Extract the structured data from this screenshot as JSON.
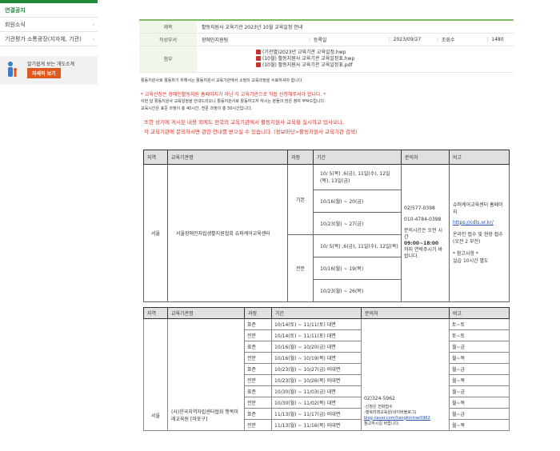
{
  "sidebar": {
    "items": [
      {
        "label": "연결공지",
        "active": true
      },
      {
        "label": "회원소식"
      },
      {
        "label": "기관평가 소통광장(지자체, 기관)"
      }
    ],
    "banner": {
      "text": "알기쉽게 보는 개도소개",
      "button": "자세히 보기"
    }
  },
  "post": {
    "title_label": "제목",
    "title": "활동지원사 교육기관 2023년 10월 교육일정 안내",
    "author_label": "작성부서",
    "author": "장애인지원팀",
    "date_label": "등록일",
    "date": "2023/09/27",
    "views_label": "조회수",
    "views": "1480",
    "attach_label": "첨부",
    "attachments": [
      "(기관별)2023년 교육기관 교육일정.hwp",
      "(10월) 활동지원사 교육기관 교육일정표.hwp",
      "(10월) 활동지원사 교육기관 교육일정표.pdf"
    ]
  },
  "content": {
    "intro": "활동지원사로 활동하기 위해서는 활동지원사 교육기관에서 소정의 교육과정을 수료하셔야 합니다.",
    "notice1": "* 교육신청은 장애인활동지원 홈페이지가 아닌 각 교육기관으로 직접 신청해주셔야 합니다. *",
    "line2": "이번 달 활동지원사 교육일정을 안내드리오니 활동지원사로 활동하고자 하시는 분들의 많은 참여 부탁드립니다.",
    "line3": "교육시간은 표준 과정이 총 40시간, 전문 과정이 총 50시간입니다.",
    "notice2": "또한 상기에 게시된 내용 외에도 전국의 교육기관에서 활동지원사 교육을 실시하고 있사오니,",
    "notice3": "각 교육기관에 문의하시면 관련 안내를 받으실 수 있습니다. (정보마당>활동지원사 교육기관 검색)"
  },
  "table1": {
    "headers": [
      "지역",
      "교육기관명",
      "과정",
      "기간",
      "문의처",
      "비고"
    ],
    "region": "서울",
    "org": "서울장애인자립생활지원협회 슈퍼케어교육센터",
    "basic": "기본",
    "adv": "전문",
    "basic_periods": [
      "10/ 5(목) ,6(금), 11일(수), 12일(목), 13일(금)",
      "10/16(월) ~ 20(금)",
      "10/23(월) ~ 27(금)"
    ],
    "adv_periods": [
      "10/ 5(목) ,6(금), 11일(수), 12일(목)",
      "10/16(월) ~ 19(목)",
      "10/23(월) ~ 26(목)"
    ],
    "phone1": "02)577-0398",
    "phone2": "010-4784-0398",
    "inquiry": "문의시간은 오전 시간",
    "hours": "09:00~18:00",
    "inquiry2": "까지 연락주시기 바랍니다.",
    "note_title": "슈퍼케어교육센터 홈페이지",
    "note_link": "https://cdls.or.kr/",
    "note1": "온라인 접수 및 현장 접수",
    "note2": "(오전 2 부전)",
    "note3": "* 참고사항 *",
    "note4": "실습 10시간 별도"
  },
  "table2": {
    "headers": [
      "지역",
      "교육기관명",
      "과정",
      "기간",
      "문의처",
      "비고"
    ],
    "region": "서울",
    "org": "(사)한국지역자립센터협회 행복미래교육원 [마포구]",
    "phone": "02)324-5962",
    "contact1": "-신청은 전화접수",
    "contact2": "-행복미래교육원(네이버블로그)",
    "contact_link": "blog.naver.com/hangkmirae5962",
    "contact3": "참고하시길 바랍니다.",
    "rows": [
      {
        "course": "표준",
        "period": "10/14(토) ~ 11/11(토) 대면",
        "note": "토~토"
      },
      {
        "course": "전문",
        "period": "10/14(토) ~ 11/11(토) 대면",
        "note": "토~토"
      },
      {
        "course": "표준",
        "period": "10/16(월) ~ 10/20(금) 대면",
        "note": "월~금"
      },
      {
        "course": "전문",
        "period": "10/16(월) ~ 10/19(목) 대면",
        "note": "월~목"
      },
      {
        "course": "표준",
        "period": "10/23(월) ~ 10/27(금) 비대면",
        "note": "월~금"
      },
      {
        "course": "전문",
        "period": "10/23(월) ~ 10/26(목) 비대면",
        "note": "월~목"
      },
      {
        "course": "표준",
        "period": "10/30(월) ~ 11/03(금) 대면",
        "note": "월~금"
      },
      {
        "course": "전문",
        "period": "10/30(월) ~ 11/02(목) 대면",
        "note": "월~목"
      },
      {
        "course": "표준",
        "period": "11/13(월) ~ 11/17(금) 비대면",
        "note": "월~금"
      },
      {
        "course": "전문",
        "period": "11/13(월) ~ 11/16(목) 비대면",
        "note": "월~목"
      }
    ]
  }
}
